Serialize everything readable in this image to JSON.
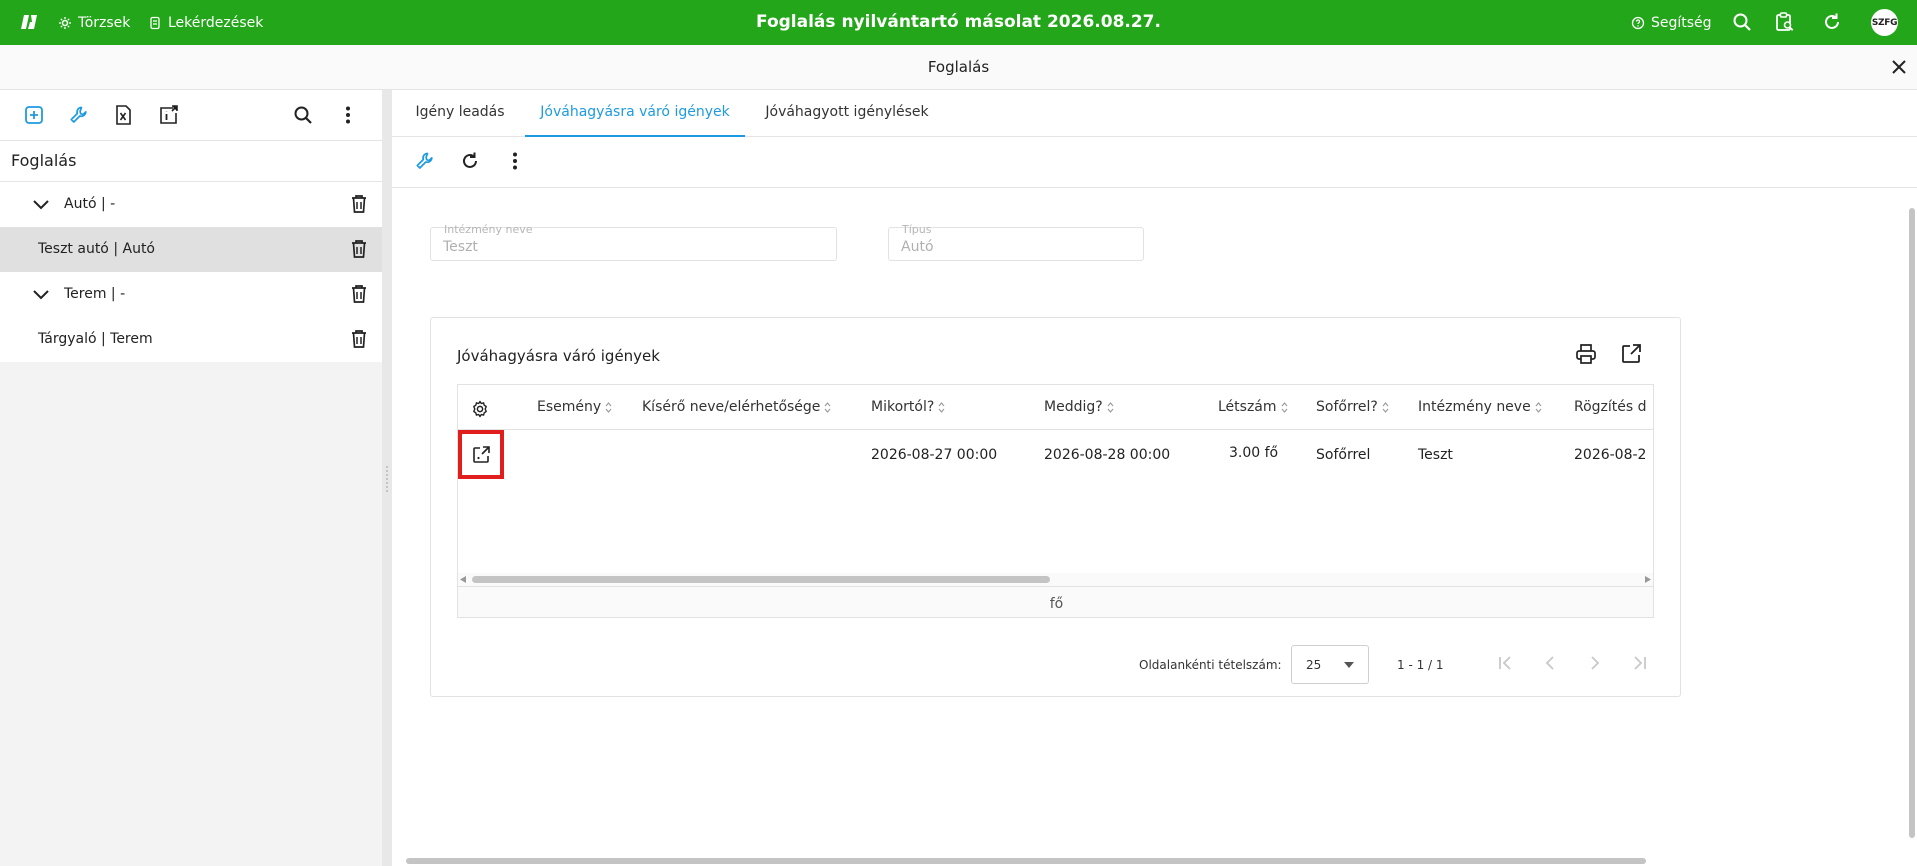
{
  "topbar": {
    "title": "Foglalás nyilvántartó másolat 2026.08.27.",
    "nav": [
      {
        "label": "Törzsek",
        "icon": "gear-icon"
      },
      {
        "label": "Lekérdezések",
        "icon": "list-icon"
      }
    ],
    "help_label": "Segítség",
    "avatar": "SZFG",
    "background": "#23a61a"
  },
  "window": {
    "title": "Foglalás"
  },
  "left_panel": {
    "heading": "Foglalás",
    "tree": [
      {
        "label": "Autó | -",
        "group": true
      },
      {
        "label": "Teszt autó | Autó",
        "group": false,
        "selected": true
      },
      {
        "label": "Terem | -",
        "group": true
      },
      {
        "label": "Tárgyaló | Terem",
        "group": false
      }
    ]
  },
  "tabs": [
    {
      "label": "Igény leadás"
    },
    {
      "label": "Jóváhagyásra váró igények",
      "active": true
    },
    {
      "label": "Jóváhagyott igénylések"
    }
  ],
  "filters": {
    "institution": {
      "label": "Intézmény neve",
      "value": "Teszt"
    },
    "type": {
      "label": "Típus",
      "value": "Autó"
    }
  },
  "table_card": {
    "title": "Jóváhagyásra váró igények",
    "columns": [
      "Esemény",
      "Kísérő neve/elérhetősége",
      "Mikortól?",
      "Meddig?",
      "Létszám",
      "Sofőrrel?",
      "Intézmény neve",
      "Rögzítés d"
    ],
    "rows": [
      {
        "event": "",
        "companion": "",
        "from": "2026-08-27 00:00",
        "to": "2026-08-28 00:00",
        "headcount": "3.00 fő",
        "with_driver": "Sofőrrel",
        "institution": "Teszt",
        "recorded": "2026-08-2"
      }
    ],
    "footer": "fő",
    "pager": {
      "label": "Oldalankénti tételszám:",
      "page_size": "25",
      "range": "1 - 1 / 1"
    }
  },
  "accent_color": "#1e9be0",
  "highlight_color": "#e01e1e"
}
